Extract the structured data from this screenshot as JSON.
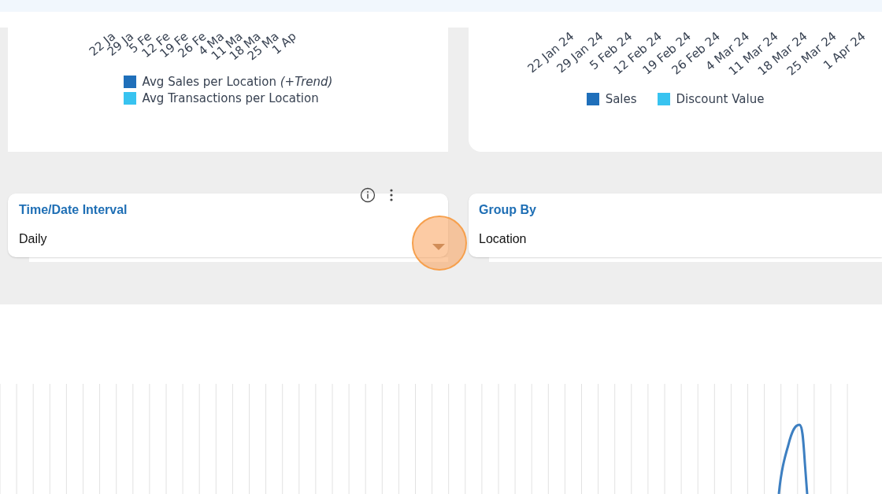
{
  "charts": [
    {
      "axis_labels": [
        "22 Ja",
        "29 Ja",
        "5 Fe",
        "12 Fe",
        "19 Fe",
        "26 Fe",
        "4 Ma",
        "11 Ma",
        "18 Ma",
        "25 Ma",
        "1 Ap"
      ],
      "legend": [
        {
          "label": "Avg Sales per Location *(+Trend)*",
          "color": "#1f6fba"
        },
        {
          "label": "Avg Transactions per Location",
          "color": "#38c3f0"
        }
      ]
    },
    {
      "axis_labels": [
        "22 Jan 24",
        "29 Jan 24",
        "5 Feb 24",
        "12 Feb 24",
        "19 Feb 24",
        "26 Feb 24",
        "4 Mar 24",
        "11 Mar 24",
        "18 Mar 24",
        "25 Mar 24",
        "1 Apr 24"
      ],
      "legend": [
        {
          "label": "Sales",
          "color": "#1f6fba"
        },
        {
          "label": "Discount Value",
          "color": "#38c3f0"
        }
      ]
    }
  ],
  "filters": [
    {
      "title": "Time/Date Interval",
      "value": "Daily",
      "actions": true,
      "highlighted": true
    },
    {
      "title": "Group By",
      "value": "Location",
      "actions": false,
      "highlighted": false
    }
  ]
}
